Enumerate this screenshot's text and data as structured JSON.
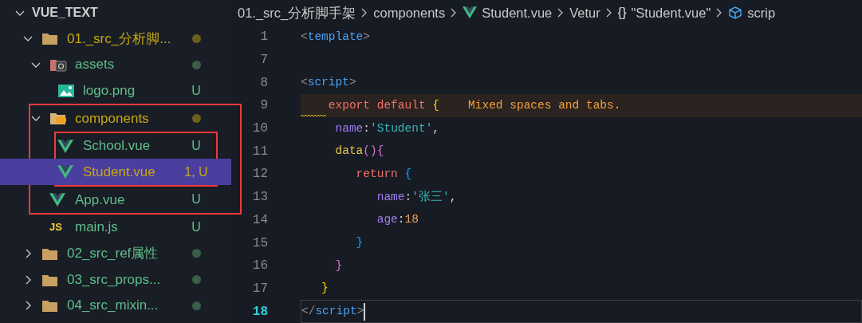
{
  "explorer": {
    "title": "VUE_TEXT",
    "expanded": true,
    "tree": [
      {
        "label": "01._src_分析脚...",
        "kind": "folder",
        "expanded": true,
        "modified": true,
        "color": "#6b5f1c",
        "selected": false,
        "outlined": false,
        "children": [
          {
            "label": "assets",
            "kind": "assets-folder",
            "expanded": true,
            "modified": false,
            "color": "#3a5f48",
            "selected": false,
            "outlined": false,
            "children": [
              {
                "label": "logo.png",
                "kind": "image",
                "modified": false,
                "badge": "U",
                "selected": false,
                "outlined": false
              }
            ]
          },
          {
            "label": "components",
            "kind": "components-folder",
            "expanded": true,
            "modified": true,
            "color": "#6b5f1c",
            "selected": false,
            "outlined": true,
            "children": [
              {
                "label": "School.vue",
                "kind": "vue",
                "modified": false,
                "badge": "U",
                "selected": false,
                "outlined": true
              },
              {
                "label": "Student.vue",
                "kind": "vue",
                "modified": true,
                "badge": "1, U",
                "selected": true,
                "outlined": true
              }
            ]
          },
          {
            "label": "App.vue",
            "kind": "vue",
            "modified": false,
            "badge": "U",
            "selected": false,
            "outlined": true
          },
          {
            "label": "main.js",
            "kind": "js",
            "icon_text": "JS",
            "modified": false,
            "badge": "U",
            "selected": false,
            "outlined": false
          }
        ]
      },
      {
        "label": "02_src_ref属性",
        "kind": "folder",
        "expanded": false,
        "modified": false,
        "color": "#3a5f48",
        "selected": false,
        "outlined": false
      },
      {
        "label": "03_src_props...",
        "kind": "folder",
        "expanded": false,
        "modified": false,
        "color": "#3a5f48",
        "selected": false,
        "outlined": false
      },
      {
        "label": "04_src_mixin...",
        "kind": "folder",
        "expanded": false,
        "modified": false,
        "color": "#3a5f48",
        "selected": false,
        "outlined": false
      }
    ]
  },
  "breadcrumb": [
    {
      "text": "01._src_分析脚手架",
      "kind": "text"
    },
    {
      "text": "components",
      "kind": "text"
    },
    {
      "text": "Student.vue",
      "kind": "vue"
    },
    {
      "text": "Vetur",
      "kind": "text"
    },
    {
      "text": "\"Student.vue\"",
      "kind": "braces",
      "icon_text": "{}"
    },
    {
      "text": "scrip",
      "kind": "cube"
    }
  ],
  "editor": {
    "lines": [
      {
        "number": "1",
        "tokens": [
          {
            "kind": "bracket",
            "t": "<"
          },
          {
            "kind": "tag",
            "t": "template"
          },
          {
            "kind": "bracket",
            "t": ">"
          }
        ]
      },
      {
        "number": "7"
      },
      {
        "number": "8",
        "tokens": [
          {
            "kind": "bracket",
            "t": "<"
          },
          {
            "kind": "tag",
            "t": "script"
          },
          {
            "kind": "bracket",
            "t": ">"
          }
        ]
      },
      {
        "number": "9",
        "warning": true,
        "message": "Mixed spaces and tabs.",
        "tokens": [
          {
            "kind": "keyword",
            "t": "    export default "
          },
          {
            "kind": "brace1",
            "t": "{"
          }
        ]
      },
      {
        "number": "10",
        "tokens": [
          {
            "kind": "property",
            "t": "     name"
          },
          {
            "kind": "punct",
            "t": ":"
          },
          {
            "kind": "string",
            "t": "'Student'"
          },
          {
            "kind": "punct",
            "t": ","
          }
        ]
      },
      {
        "number": "11",
        "tokens": [
          {
            "kind": "function",
            "t": "     data"
          },
          {
            "kind": "brace2",
            "t": "(){"
          }
        ]
      },
      {
        "number": "12",
        "tokens": [
          {
            "kind": "keyword",
            "t": "        return "
          },
          {
            "kind": "brace3",
            "t": "{"
          }
        ]
      },
      {
        "number": "13",
        "tokens": [
          {
            "kind": "property",
            "t": "           name"
          },
          {
            "kind": "punct",
            "t": ":"
          },
          {
            "kind": "string",
            "t": "'张三'"
          },
          {
            "kind": "punct",
            "t": ","
          }
        ]
      },
      {
        "number": "14",
        "tokens": [
          {
            "kind": "property",
            "t": "           age"
          },
          {
            "kind": "punct",
            "t": ":"
          },
          {
            "kind": "number",
            "t": "18"
          }
        ]
      },
      {
        "number": "15",
        "tokens": [
          {
            "kind": "brace3",
            "t": "        }"
          }
        ]
      },
      {
        "number": "16",
        "tokens": [
          {
            "kind": "brace2",
            "t": "     }"
          }
        ]
      },
      {
        "number": "17",
        "tokens": [
          {
            "kind": "brace1",
            "t": "   }"
          }
        ]
      },
      {
        "number": "18",
        "current": true,
        "tokens": [
          {
            "kind": "bracket",
            "t": "</"
          },
          {
            "kind": "tag",
            "t": "script"
          },
          {
            "kind": "bracket",
            "t": ">"
          }
        ]
      }
    ]
  }
}
